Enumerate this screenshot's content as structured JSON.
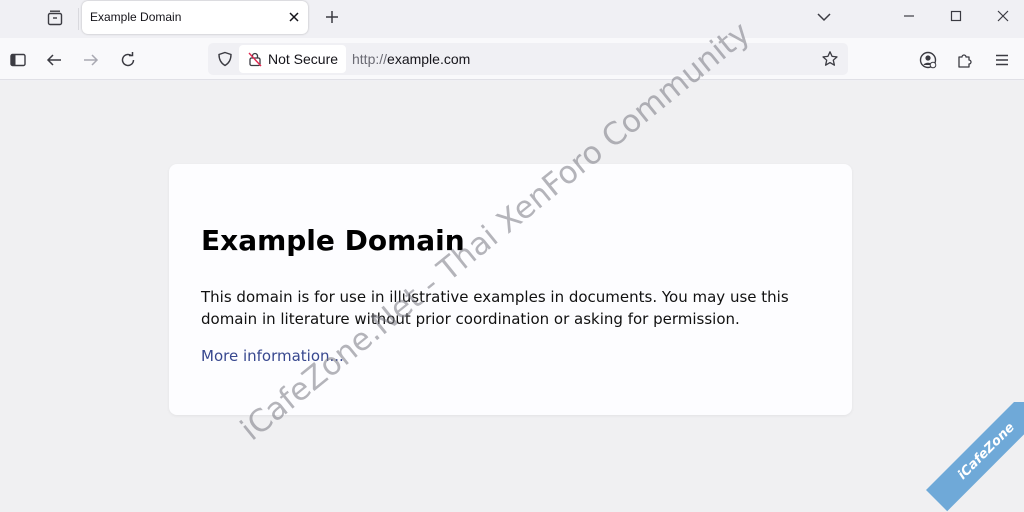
{
  "tab": {
    "title": "Example Domain"
  },
  "urlbar": {
    "security_label": "Not Secure",
    "url_scheme": "http://",
    "url_host": "example.com"
  },
  "page": {
    "heading": "Example Domain",
    "description": "This domain is for use in illustrative examples in documents. You may use this domain in literature without prior coordination or asking for permission.",
    "link_text": "More information..."
  },
  "watermark": {
    "text": "iCafeZone.Net - Thai XenForo Community",
    "ribbon_text": "iCafeZone"
  },
  "icons": {
    "tab_overview": "tab-overview-icon",
    "close": "close-icon",
    "new_tab": "plus-icon",
    "list_all_tabs": "chevron-down-icon",
    "minimize": "minimize-icon",
    "maximize": "maximize-icon",
    "window_close": "window-close-icon",
    "sidebar": "sidebar-icon",
    "back": "back-arrow-icon",
    "forward": "forward-arrow-icon",
    "reload": "reload-icon",
    "tracking_protection": "shield-icon",
    "insecure_lock": "insecure-lock-icon",
    "bookmark": "star-icon",
    "account": "account-icon",
    "extensions": "puzzle-icon",
    "menu": "hamburger-menu-icon"
  },
  "colors": {
    "link": "#38488f",
    "chrome_bg": "#f0f0f4",
    "card_bg": "#fdfdff",
    "ribbon": "#6fa9d8"
  }
}
